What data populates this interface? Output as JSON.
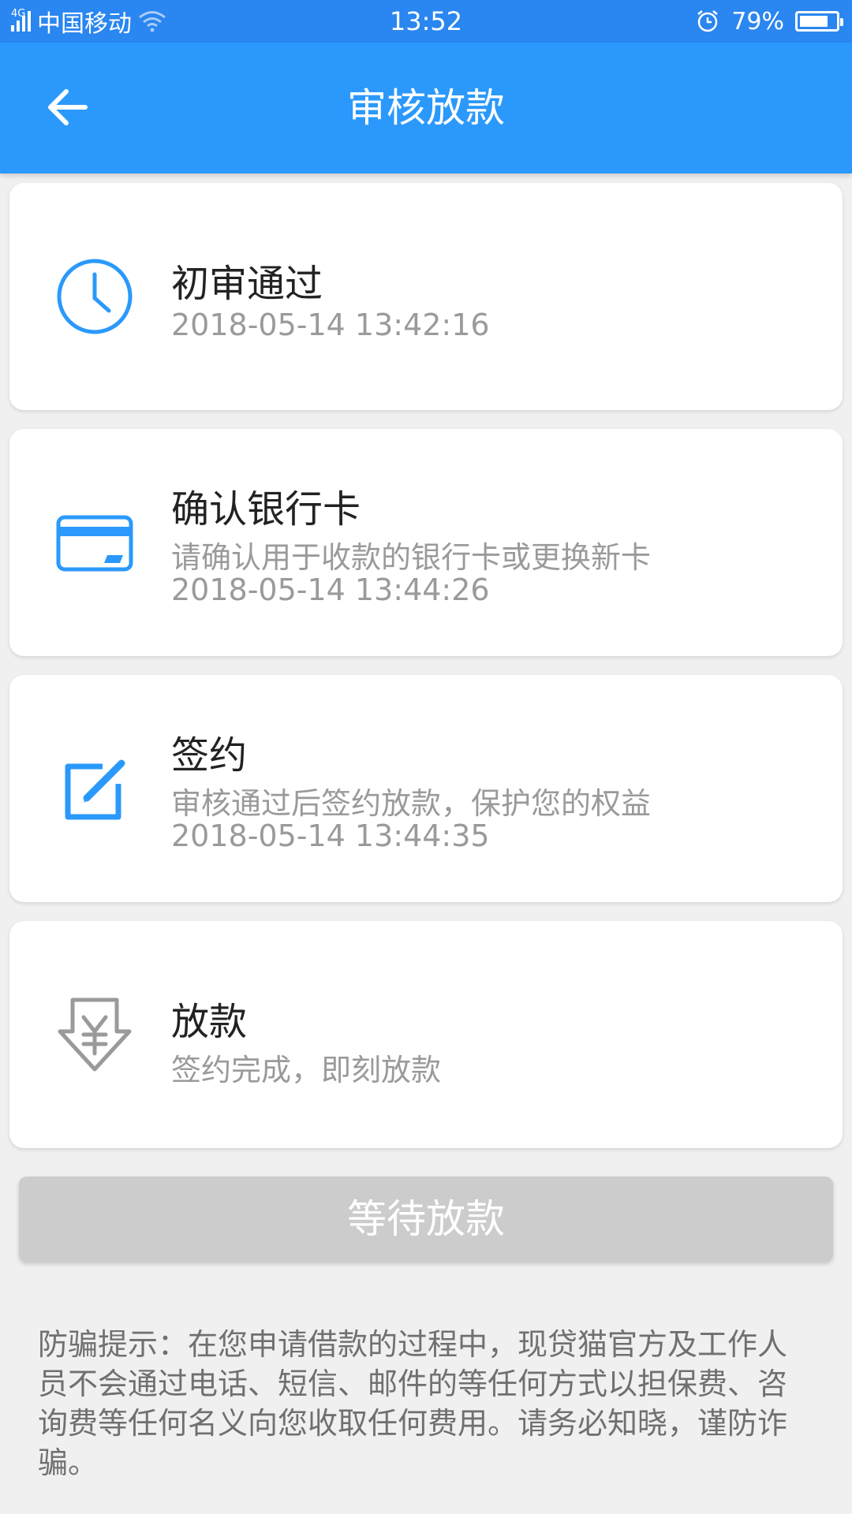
{
  "status_bar": {
    "network": "4G",
    "carrier": "中国移动",
    "time": "13:52",
    "battery_percent": "79%",
    "battery_level": 0.79
  },
  "header": {
    "title": "审核放款",
    "back_icon": "arrow-left-icon"
  },
  "steps": [
    {
      "icon": "clock-icon",
      "title": "初审通过",
      "desc": "",
      "time": "2018-05-14 13:42:16",
      "color": "#2a99fb"
    },
    {
      "icon": "bank-card-icon",
      "title": "确认银行卡",
      "desc": "请确认用于收款的银行卡或更换新卡",
      "time": "2018-05-14 13:44:26",
      "color": "#2a99fb"
    },
    {
      "icon": "edit-icon",
      "title": "签约",
      "desc": "审核通过后签约放款，保护您的权益",
      "time": "2018-05-14 13:44:35",
      "color": "#2a99fb"
    },
    {
      "icon": "yuan-download-icon",
      "title": "放款",
      "desc": "签约完成，即刻放款",
      "time": "",
      "color": "#9a9a9a"
    }
  ],
  "button": {
    "label": "等待放款"
  },
  "notice": {
    "text": "防骗提示：在您申请借款的过程中，现贷猫官方及工作人员不会通过电话、短信、邮件的等任何方式以担保费、咨询费等任何名义向您收取任何费用。请务必知晓，谨防诈骗。"
  }
}
